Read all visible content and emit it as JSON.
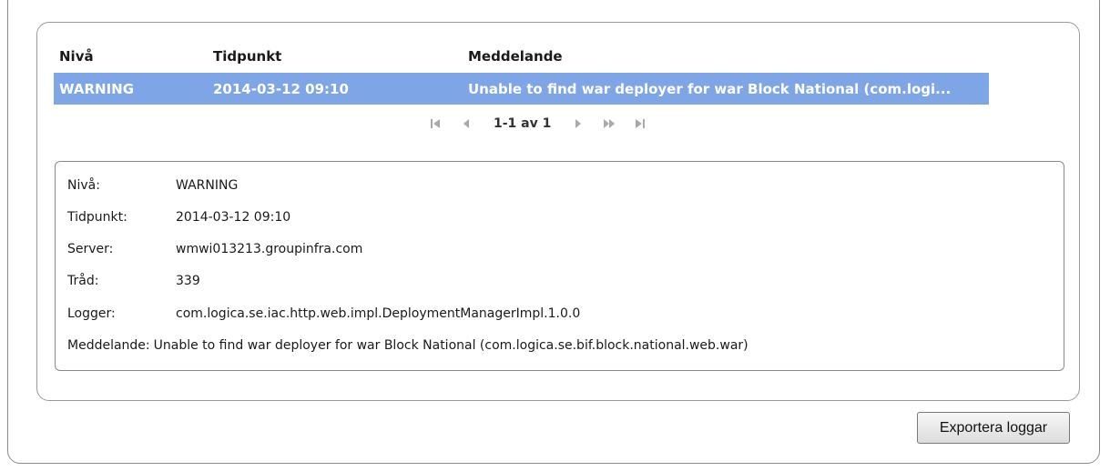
{
  "table": {
    "headers": {
      "level": "Nivå",
      "time": "Tidpunkt",
      "message": "Meddelande"
    },
    "rows": [
      {
        "level": "WARNING",
        "time": "2014-03-12 09:10",
        "message": "Unable to find war deployer for war Block National (com.logi..."
      }
    ],
    "selected_row_color": "#7ea6e6"
  },
  "pager": {
    "info": "1-1 av 1",
    "icons": [
      "first-page-icon",
      "prev-page-icon",
      "next-page-icon",
      "fast-forward-icon",
      "last-page-icon"
    ]
  },
  "detail": {
    "level": {
      "label": "Nivå:",
      "value": "WARNING"
    },
    "time": {
      "label": "Tidpunkt:",
      "value": "2014-03-12 09:10"
    },
    "server": {
      "label": "Server:",
      "value": "wmwi013213.groupinfra.com"
    },
    "thread": {
      "label": "Tråd:",
      "value": "339"
    },
    "logger": {
      "label": "Logger:",
      "value": "com.logica.se.iac.http.web.impl.DeploymentManagerImpl.1.0.0"
    },
    "message": {
      "label": "Meddelande:",
      "value": "Unable to find war deployer for war Block National (com.logica.se.bif.block.national.web.war)"
    }
  },
  "actions": {
    "export_label": "Exportera loggar"
  }
}
